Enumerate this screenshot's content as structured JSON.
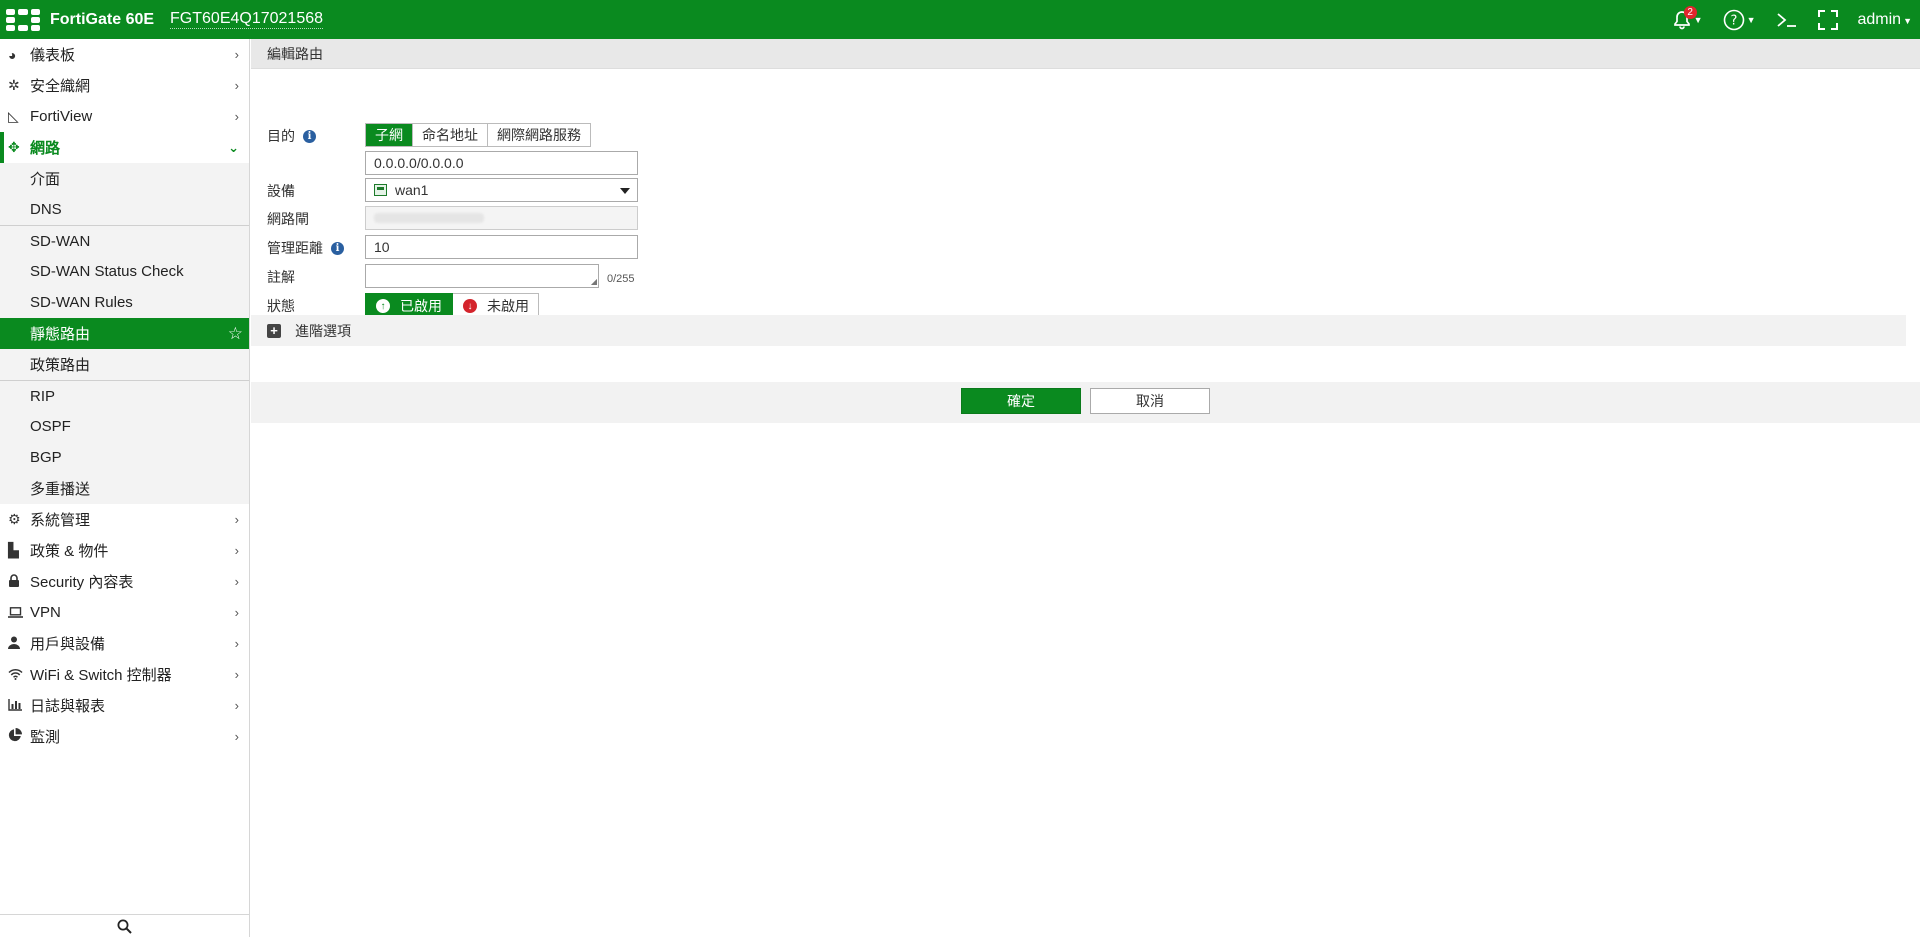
{
  "topbar": {
    "product": "FortiGate 60E",
    "hostname": "FGT60E4Q17021568",
    "notifications_count": "2",
    "admin_label": "admin"
  },
  "sidebar": {
    "top_items": [
      {
        "label": "儀表板",
        "icon": "dashboard-icon"
      },
      {
        "label": "安全織網",
        "icon": "security-fabric-icon"
      },
      {
        "label": "FortiView",
        "icon": "fortiview-icon"
      }
    ],
    "network": {
      "label": "網路",
      "icon": "network-icon",
      "expanded": true
    },
    "network_sub": [
      {
        "label": "介面"
      },
      {
        "label": "DNS"
      },
      {
        "label": "SD-WAN"
      },
      {
        "label": "SD-WAN Status Check"
      },
      {
        "label": "SD-WAN Rules"
      },
      {
        "label": "靜態路由",
        "active": true
      },
      {
        "label": "政策路由"
      },
      {
        "label": "RIP"
      },
      {
        "label": "OSPF"
      },
      {
        "label": "BGP"
      },
      {
        "label": "多重播送"
      }
    ],
    "bottom_items": [
      {
        "label": "系統管理",
        "icon": "gear-icon"
      },
      {
        "label": "政策 & 物件",
        "icon": "policy-icon"
      },
      {
        "label": "Security 內容表",
        "icon": "lock-icon"
      },
      {
        "label": "VPN",
        "icon": "laptop-icon"
      },
      {
        "label": "用戶與設備",
        "icon": "user-icon"
      },
      {
        "label": "WiFi & Switch 控制器",
        "icon": "wifi-icon"
      },
      {
        "label": "日誌與報表",
        "icon": "bar-chart-icon"
      },
      {
        "label": "監測",
        "icon": "pie-chart-icon"
      }
    ]
  },
  "page": {
    "title": "編輯路由"
  },
  "form": {
    "destination_label": "目的",
    "destination_tabs": [
      "子網",
      "命名地址",
      "網際網路服務"
    ],
    "destination_selected": "子網",
    "destination_value": "0.0.0.0/0.0.0.0",
    "device_label": "設備",
    "device_value": "wan1",
    "gateway_label": "網路閘",
    "distance_label": "管理距離",
    "distance_value": "10",
    "comment_label": "註解",
    "comment_count": "0/255",
    "status_label": "狀態",
    "status_enabled": "已啟用",
    "status_disabled": "未啟用",
    "advanced_label": "進階選項"
  },
  "buttons": {
    "ok": "確定",
    "cancel": "取消"
  },
  "colors": {
    "brand_green": "#0a8a1f",
    "error_red": "#d4242c",
    "info_blue": "#2a5fa0"
  }
}
